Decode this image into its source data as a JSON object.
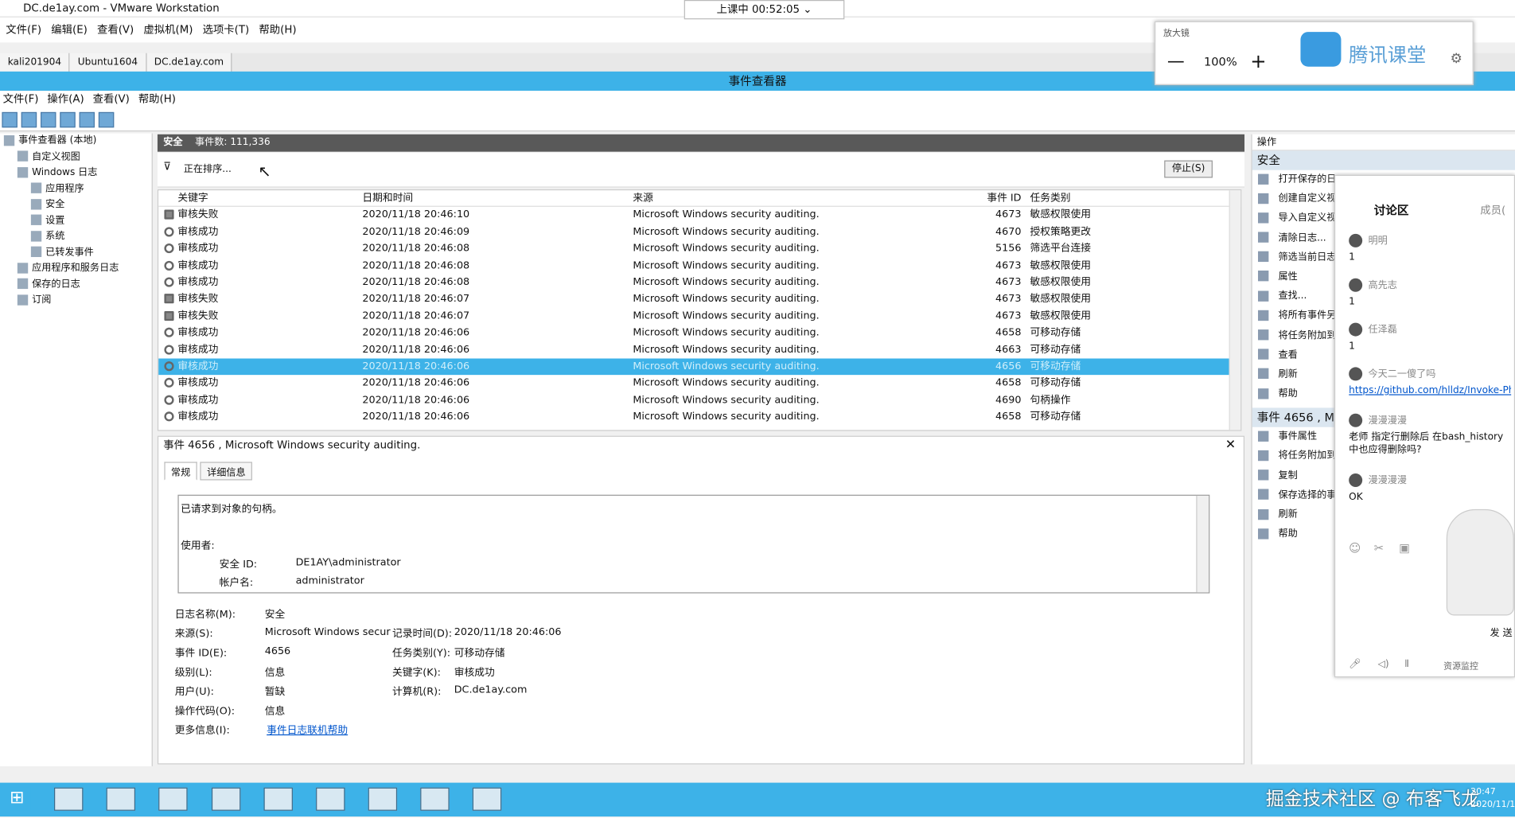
{
  "vmware": {
    "title": "DC.de1ay.com - VMware Workstation",
    "menu": [
      "文件(F)",
      "编辑(E)",
      "查看(V)",
      "虚拟机(M)",
      "选项卡(T)",
      "帮助(H)"
    ],
    "timer": "上课中 00:52:05",
    "tabs": [
      "kali201904",
      "Ubuntu1604",
      "DC.de1ay.com"
    ]
  },
  "zoom": {
    "title": "放大镜",
    "level": "100%",
    "minus": "—",
    "plus": "+"
  },
  "brand": "腾讯课堂",
  "event_viewer": {
    "title": "事件查看器",
    "menu": [
      "文件(F)",
      "操作(A)",
      "查看(V)",
      "帮助(H)"
    ],
    "tree": [
      {
        "label": "事件查看器 (本地)",
        "indent": 0
      },
      {
        "label": "自定义视图",
        "indent": 1
      },
      {
        "label": "Windows 日志",
        "indent": 1
      },
      {
        "label": "应用程序",
        "indent": 2
      },
      {
        "label": "安全",
        "indent": 2
      },
      {
        "label": "设置",
        "indent": 2
      },
      {
        "label": "系统",
        "indent": 2
      },
      {
        "label": "已转发事件",
        "indent": 2
      },
      {
        "label": "应用程序和服务日志",
        "indent": 1
      },
      {
        "label": "保存的日志",
        "indent": 1
      },
      {
        "label": "订阅",
        "indent": 1
      }
    ],
    "log_header": {
      "name": "安全",
      "count": "事件数: 111,336"
    },
    "filter_status": "正在排序...",
    "stop_button": "停止(S)",
    "columns": [
      "关键字",
      "日期和时间",
      "来源",
      "事件 ID",
      "任务类别"
    ],
    "rows": [
      {
        "k": "审核失败",
        "t": "2020/11/18 20:46:10",
        "s": "Microsoft Windows security auditing.",
        "id": "4673",
        "c": "敏感权限使用",
        "lock": true
      },
      {
        "k": "审核成功",
        "t": "2020/11/18 20:46:09",
        "s": "Microsoft Windows security auditing.",
        "id": "4670",
        "c": "授权策略更改",
        "lock": false
      },
      {
        "k": "审核成功",
        "t": "2020/11/18 20:46:08",
        "s": "Microsoft Windows security auditing.",
        "id": "5156",
        "c": "筛选平台连接",
        "lock": false
      },
      {
        "k": "审核成功",
        "t": "2020/11/18 20:46:08",
        "s": "Microsoft Windows security auditing.",
        "id": "4673",
        "c": "敏感权限使用",
        "lock": false
      },
      {
        "k": "审核成功",
        "t": "2020/11/18 20:46:08",
        "s": "Microsoft Windows security auditing.",
        "id": "4673",
        "c": "敏感权限使用",
        "lock": false
      },
      {
        "k": "审核失败",
        "t": "2020/11/18 20:46:07",
        "s": "Microsoft Windows security auditing.",
        "id": "4673",
        "c": "敏感权限使用",
        "lock": true
      },
      {
        "k": "审核失败",
        "t": "2020/11/18 20:46:07",
        "s": "Microsoft Windows security auditing.",
        "id": "4673",
        "c": "敏感权限使用",
        "lock": true
      },
      {
        "k": "审核成功",
        "t": "2020/11/18 20:46:06",
        "s": "Microsoft Windows security auditing.",
        "id": "4658",
        "c": "可移动存储",
        "lock": false
      },
      {
        "k": "审核成功",
        "t": "2020/11/18 20:46:06",
        "s": "Microsoft Windows security auditing.",
        "id": "4663",
        "c": "可移动存储",
        "lock": false
      },
      {
        "k": "审核成功",
        "t": "2020/11/18 20:46:06",
        "s": "Microsoft Windows security auditing.",
        "id": "4656",
        "c": "可移动存储",
        "lock": false,
        "selected": true
      },
      {
        "k": "审核成功",
        "t": "2020/11/18 20:46:06",
        "s": "Microsoft Windows security auditing.",
        "id": "4658",
        "c": "可移动存储",
        "lock": false
      },
      {
        "k": "审核成功",
        "t": "2020/11/18 20:46:06",
        "s": "Microsoft Windows security auditing.",
        "id": "4690",
        "c": "句柄操作",
        "lock": false
      },
      {
        "k": "审核成功",
        "t": "2020/11/18 20:46:06",
        "s": "Microsoft Windows security auditing.",
        "id": "4658",
        "c": "可移动存储",
        "lock": false
      }
    ],
    "detail": {
      "title": "事件 4656 , Microsoft Windows security auditing.",
      "tabs": [
        "常规",
        "详细信息"
      ],
      "message": "已请求到对象的句柄。",
      "subject_label": "使用者:",
      "sid_label": "安全 ID:",
      "sid_value": "DE1AY\\administrator",
      "account_label": "帐户名:",
      "account_value": "administrator",
      "fields": {
        "log_name_l": "日志名称(M):",
        "log_name_v": "安全",
        "source_l": "来源(S):",
        "source_v": "Microsoft Windows secur",
        "logged_l": "记录时间(D):",
        "logged_v": "2020/11/18 20:46:06",
        "id_l": "事件 ID(E):",
        "id_v": "4656",
        "task_l": "任务类别(Y):",
        "task_v": "可移动存储",
        "level_l": "级别(L):",
        "level_v": "信息",
        "kw_l": "关键字(K):",
        "kw_v": "审核成功",
        "user_l": "用户(U):",
        "user_v": "暂缺",
        "comp_l": "计算机(R):",
        "comp_v": "DC.de1ay.com",
        "op_l": "操作代码(O):",
        "op_v": "信息",
        "more_l": "更多信息(I):",
        "more_v": "事件日志联机帮助"
      }
    },
    "actions": {
      "header": "操作",
      "section1": "安全",
      "items1": [
        "打开保存的日",
        "创建自定义视",
        "导入自定义视",
        "清除日志...",
        "筛选当前日志",
        "属性",
        "查找...",
        "将所有事件另",
        "将任务附加到",
        "查看",
        "刷新",
        "帮助"
      ],
      "section2": "事件 4656 , M",
      "items2": [
        "事件属性",
        "将任务附加到",
        "复制",
        "保存选择的事",
        "刷新",
        "帮助"
      ]
    }
  },
  "chat": {
    "title": "讨论区",
    "members": "成员(",
    "messages": [
      {
        "user": "明明",
        "text": "1"
      },
      {
        "user": "高先志",
        "text": "1"
      },
      {
        "user": "任泽磊",
        "text": "1"
      },
      {
        "user": "今天二一傻了吗",
        "text": "https://github.com/hlldz/Invoke-Ph"
      },
      {
        "user": "漫漫漫漫",
        "text": "老师  指定行删除后 在bash_history中也应得删除吗?"
      },
      {
        "user": "漫漫漫漫",
        "text": "OK"
      }
    ],
    "send": "发 送",
    "monitor": "资源监控"
  },
  "watermark": "掘金技术社区 @ 布客飞龙",
  "clock": {
    "time": "20:47",
    "date": "2020/11/1"
  }
}
